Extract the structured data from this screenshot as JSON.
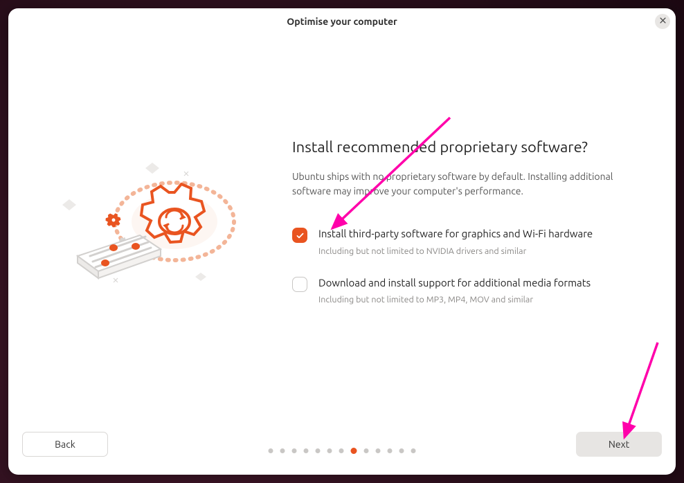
{
  "window_title": "Optimise your computer",
  "heading": "Install recommended proprietary software?",
  "subtext": "Ubuntu ships with no proprietary software by default. Installing additional software may improve your computer's performance.",
  "options": [
    {
      "label": "Install third-party software for graphics and Wi-Fi hardware",
      "sub": "Including but not limited to NVIDIA drivers and similar",
      "checked": true
    },
    {
      "label": "Download and install support for additional media formats",
      "sub": "Including but not limited to MP3, MP4, MOV and similar",
      "checked": false
    }
  ],
  "buttons": {
    "back": "Back",
    "next": "Next"
  },
  "progress": {
    "total": 13,
    "current": 8
  },
  "colors": {
    "accent": "#e95420"
  }
}
